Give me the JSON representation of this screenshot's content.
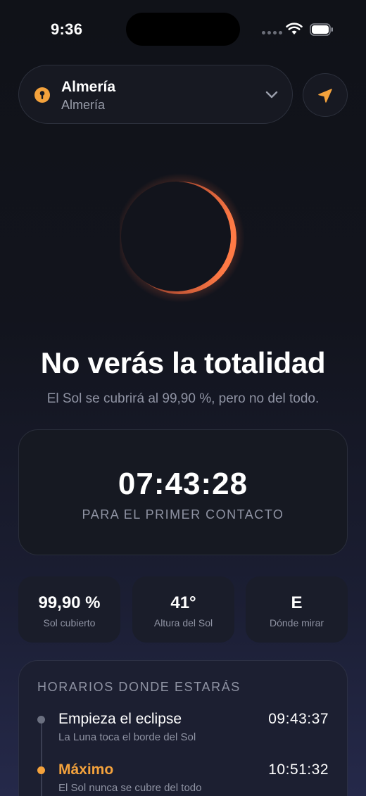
{
  "status_bar": {
    "time": "9:36"
  },
  "location": {
    "title": "Almería",
    "subtitle": "Almería"
  },
  "headline": "No verás la totalidad",
  "subline": "El Sol se cubrirá al 99,90 %, pero no del todo.",
  "countdown": {
    "time": "07:43:28",
    "label": "PARA EL PRIMER CONTACTO"
  },
  "stats": [
    {
      "value": "99,90 %",
      "label": "Sol cubierto"
    },
    {
      "value": "41°",
      "label": "Altura del Sol"
    },
    {
      "value": "E",
      "label": "Dónde mirar"
    }
  ],
  "schedule": {
    "title": "HORARIOS DONDE ESTARÁS",
    "events": [
      {
        "title": "Empieza el eclipse",
        "description": "La Luna toca el borde del Sol",
        "time": "09:43:37"
      },
      {
        "title": "Máximo",
        "description": "El Sol nunca se cubre del todo",
        "time": "10:51:32"
      }
    ]
  },
  "colors": {
    "accent": "#f4a23c",
    "corona": "#ff7a45",
    "muted_dot": "#6b7080"
  },
  "icons": {
    "location": "pin-icon",
    "dropdown": "chevron-down-icon",
    "locate": "navigation-arrow-icon"
  }
}
